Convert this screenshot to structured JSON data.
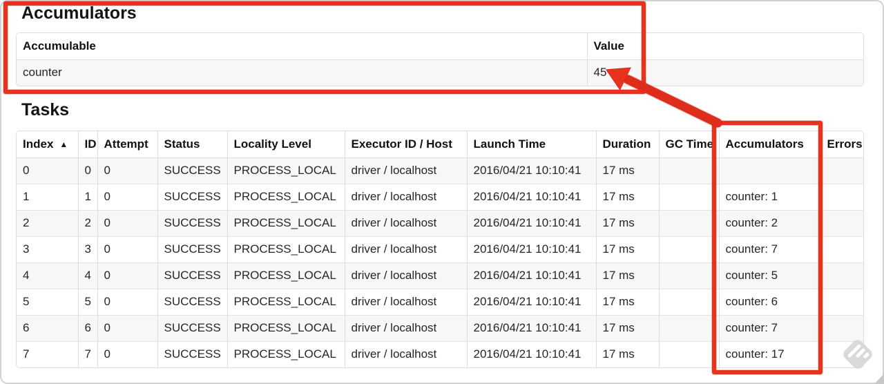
{
  "accumulators_section": {
    "title": "Accumulators",
    "headers": [
      "Accumulable",
      "Value"
    ],
    "rows": [
      [
        "counter",
        "45"
      ]
    ]
  },
  "tasks_section": {
    "title": "Tasks",
    "headers": [
      "Index",
      "ID",
      "Attempt",
      "Status",
      "Locality Level",
      "Executor ID / Host",
      "Launch Time",
      "Duration",
      "GC Time",
      "Accumulators",
      "Errors"
    ],
    "sort_column": "Index",
    "sort_indicator": "▲",
    "rows": [
      [
        "0",
        "0",
        "0",
        "SUCCESS",
        "PROCESS_LOCAL",
        "driver / localhost",
        "2016/04/21 10:10:41",
        "17 ms",
        "",
        "",
        ""
      ],
      [
        "1",
        "1",
        "0",
        "SUCCESS",
        "PROCESS_LOCAL",
        "driver / localhost",
        "2016/04/21 10:10:41",
        "17 ms",
        "",
        "counter: 1",
        ""
      ],
      [
        "2",
        "2",
        "0",
        "SUCCESS",
        "PROCESS_LOCAL",
        "driver / localhost",
        "2016/04/21 10:10:41",
        "17 ms",
        "",
        "counter: 2",
        ""
      ],
      [
        "3",
        "3",
        "0",
        "SUCCESS",
        "PROCESS_LOCAL",
        "driver / localhost",
        "2016/04/21 10:10:41",
        "17 ms",
        "",
        "counter: 7",
        ""
      ],
      [
        "4",
        "4",
        "0",
        "SUCCESS",
        "PROCESS_LOCAL",
        "driver / localhost",
        "2016/04/21 10:10:41",
        "17 ms",
        "",
        "counter: 5",
        ""
      ],
      [
        "5",
        "5",
        "0",
        "SUCCESS",
        "PROCESS_LOCAL",
        "driver / localhost",
        "2016/04/21 10:10:41",
        "17 ms",
        "",
        "counter: 6",
        ""
      ],
      [
        "6",
        "6",
        "0",
        "SUCCESS",
        "PROCESS_LOCAL",
        "driver / localhost",
        "2016/04/21 10:10:41",
        "17 ms",
        "",
        "counter: 7",
        ""
      ],
      [
        "7",
        "7",
        "0",
        "SUCCESS",
        "PROCESS_LOCAL",
        "driver / localhost",
        "2016/04/21 10:10:41",
        "17 ms",
        "",
        "counter: 17",
        ""
      ]
    ]
  },
  "annotations": {
    "accent_color": "#e8321e",
    "highlighted_value": "45",
    "highlighted_column": "Accumulators"
  },
  "watermark": {
    "icon": "feedly-style-diamond-icon",
    "color": "#d9d9d9"
  }
}
